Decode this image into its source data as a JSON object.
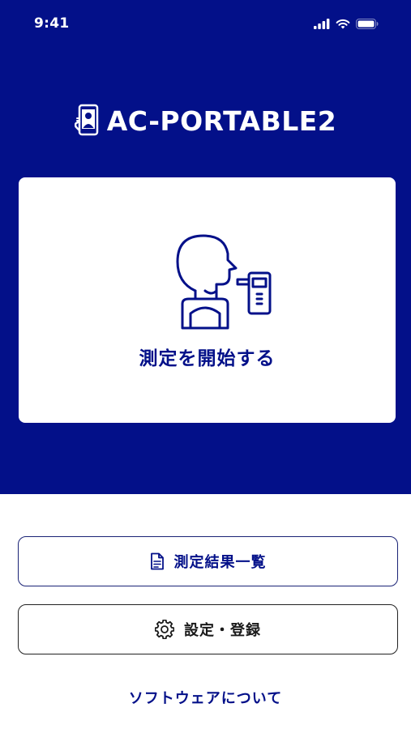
{
  "status_bar": {
    "time": "9:41",
    "icons": [
      "cellular-signal-icon",
      "wifi-icon",
      "battery-icon"
    ]
  },
  "header": {
    "brand_icon": "phone-person-icon",
    "app_title": "AC-PORTABLE2"
  },
  "start_card": {
    "illustration_icon": "person-breathalyzer-icon",
    "label": "測定を開始する"
  },
  "actions": {
    "results_label": "測定結果一覧",
    "results_icon": "document-icon",
    "settings_label": "設定・登録",
    "settings_icon": "gear-icon"
  },
  "footer": {
    "about_link": "ソフトウェアについて"
  },
  "colors": {
    "brand_navy": "#031089",
    "background": "#ffffff",
    "card": "#ffffff"
  }
}
